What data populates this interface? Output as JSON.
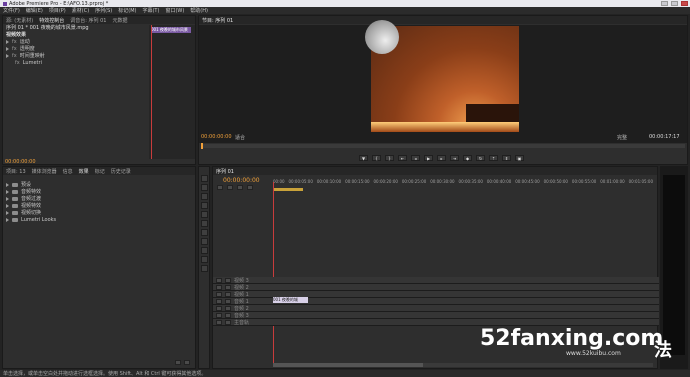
{
  "window": {
    "title": "Adobe Premiere Pro - E:\\AFO.13.prproj *"
  },
  "menu": [
    "文件(F)",
    "编辑(E)",
    "项目(P)",
    "素材(C)",
    "序列(S)",
    "标记(M)",
    "字幕(T)",
    "窗口(W)",
    "帮助(H)"
  ],
  "effect_controls": {
    "tabs": [
      "源: (无素材)",
      "特效控制台",
      "调音台: 序列 01",
      "元数据"
    ],
    "active_tab": 1,
    "header": "序列 01 * 001 夜晚的城市风景.mpg",
    "clip_label": "001 夜晚的城市风景",
    "video_effects_label": "视频效果",
    "effects": [
      {
        "name": "运动",
        "type": "fx"
      },
      {
        "name": "透明度",
        "type": "fx"
      },
      {
        "name": "时间重映射",
        "type": "fx"
      }
    ],
    "audio_label": "Lumetri",
    "timecode": "00:00:00:00"
  },
  "program_monitor": {
    "tab": "节目: 序列 01",
    "timecode_left": "00:00:00:00",
    "fit_label": "适合",
    "quality_label": "完整",
    "timecode_right": "00:00:17:17"
  },
  "project": {
    "tabs": [
      "项目: 13",
      "媒体浏览器",
      "信息",
      "效果",
      "标记",
      "历史记录"
    ],
    "active_tab": 3,
    "folders": [
      "预设",
      "音频特效",
      "音频过渡",
      "视频特效",
      "视频切换",
      "Lumetri Looks"
    ]
  },
  "timeline": {
    "tab": "序列 01",
    "timecode": "00:00:00:00",
    "ruler": [
      "00:00",
      "00:00:05:00",
      "00:00:10:00",
      "00:00:15:00",
      "00:00:20:00",
      "00:00:25:00",
      "00:00:30:00",
      "00:00:35:00",
      "00:00:40:00",
      "00:00:45:00",
      "00:00:50:00",
      "00:00:55:00",
      "00:01:00:00",
      "00:01:05:00"
    ],
    "video_tracks": [
      "视频 3",
      "视频 2",
      "视频 1"
    ],
    "audio_tracks": [
      "音频 1",
      "音频 2",
      "音频 3"
    ],
    "master_label": "主音轨",
    "clip_label": "001 夜晚的城"
  },
  "status_bar": {
    "text": "单击选择，或单击空白处并拖动进行选框选择。使用 Shift、Alt 和 Ctrl 键可获得其他选项。"
  },
  "watermark": {
    "site": "52fanxing.com",
    "small": "www.52kuibu.com",
    "corner_glyph": "法"
  }
}
